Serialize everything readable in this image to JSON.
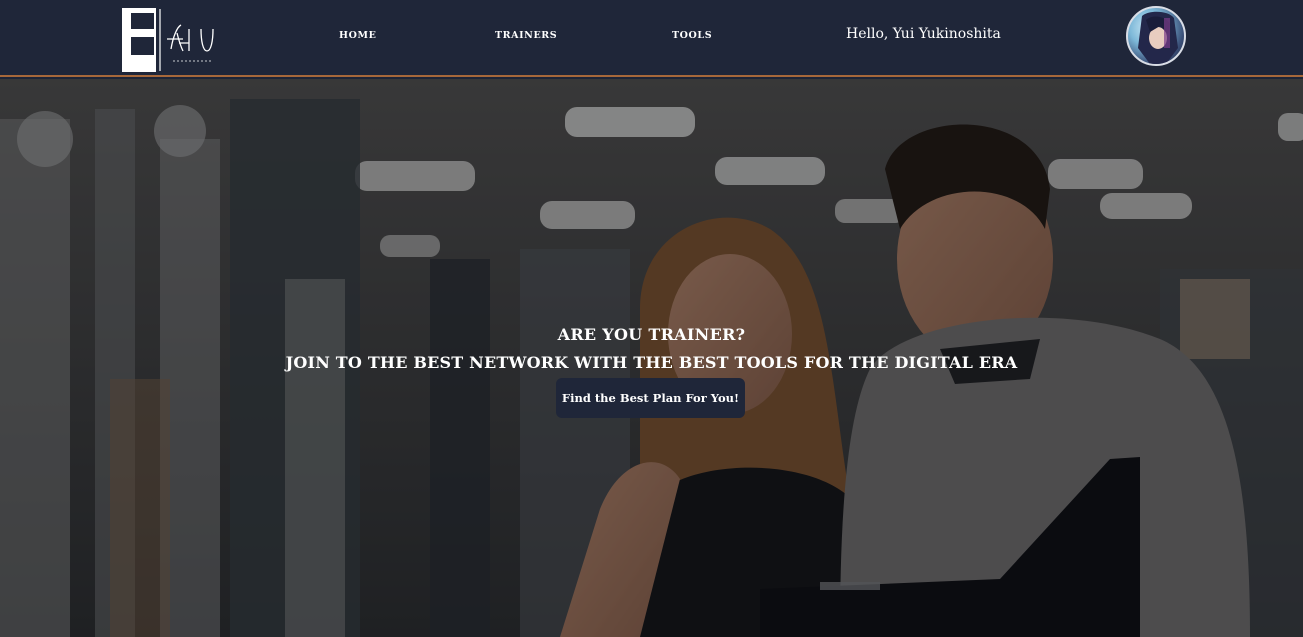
{
  "header": {
    "logo_alt": "Fit U logo",
    "nav": {
      "home": "HOME",
      "trainers": "TRAINERS",
      "tools": "TOOLS"
    },
    "greeting": "Hello, Yui Yukinoshita"
  },
  "hero": {
    "title": "ARE YOU TRAINER?",
    "subtitle": "JOIN TO THE BEST NETWORK WITH THE BEST TOOLS FOR THE DIGITAL ERA",
    "cta_label": "Find the Best Plan For You!"
  },
  "colors": {
    "header_bg": "#1f2639",
    "header_border": "#a7683a",
    "button_bg": "#1f2639",
    "text": "#ffffff"
  }
}
